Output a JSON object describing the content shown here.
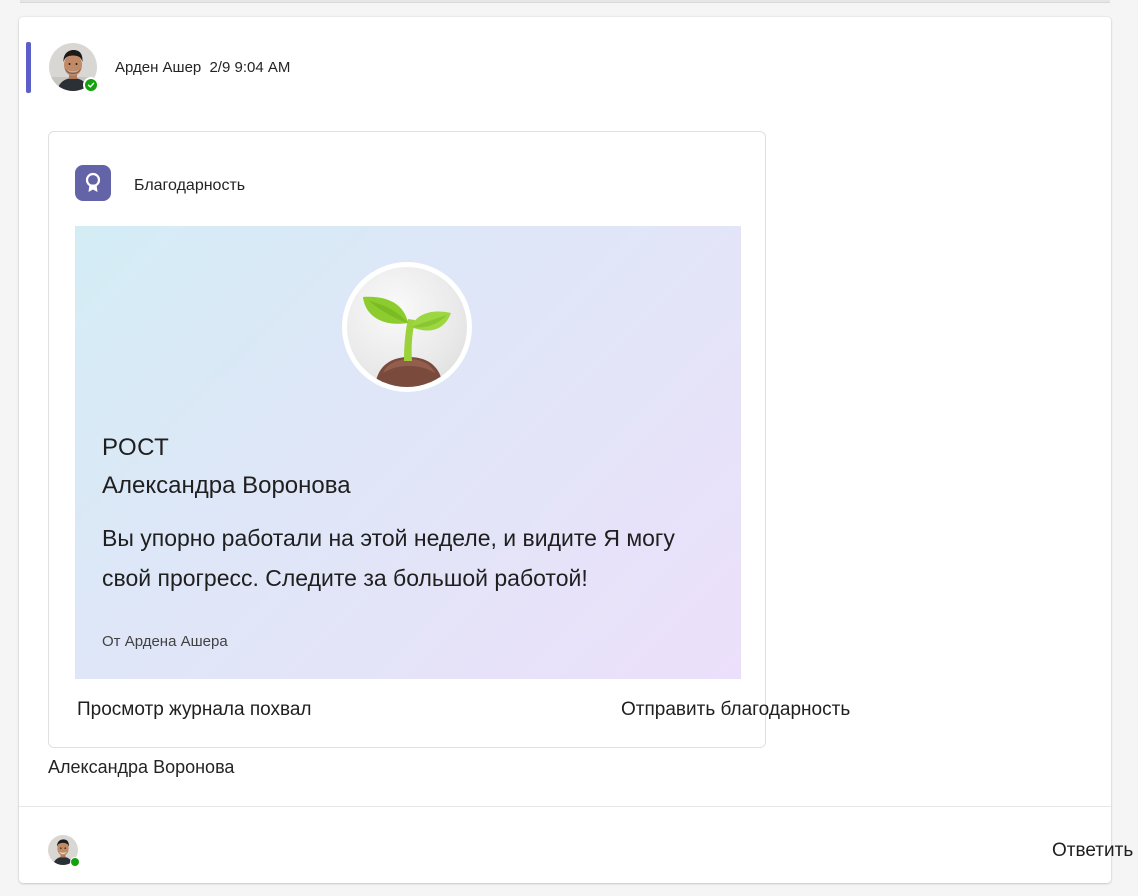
{
  "post": {
    "author": "Арден Ашер",
    "timestamp": "2/9 9:04 AM",
    "accent_color": "#5b5fc7",
    "presence": "available"
  },
  "praise_card": {
    "app_title": "Благодарность",
    "app_icon": "award-ribbon-icon",
    "badge_icon": "seedling-icon",
    "badge_name": "РОСТ",
    "recipient": "Александра Воронова",
    "message": "Вы упорно работали на этой неделе, и видите  Я могу свой прогресс. Следите за большой работой!",
    "from": "От Ардена Ашера",
    "actions": {
      "view_history": "Просмотр журнала похвал",
      "send_praise": "Отправить благодарность"
    }
  },
  "footer": {
    "mentioned_name": "Александра Воронова",
    "reply_label": "Ответить"
  }
}
